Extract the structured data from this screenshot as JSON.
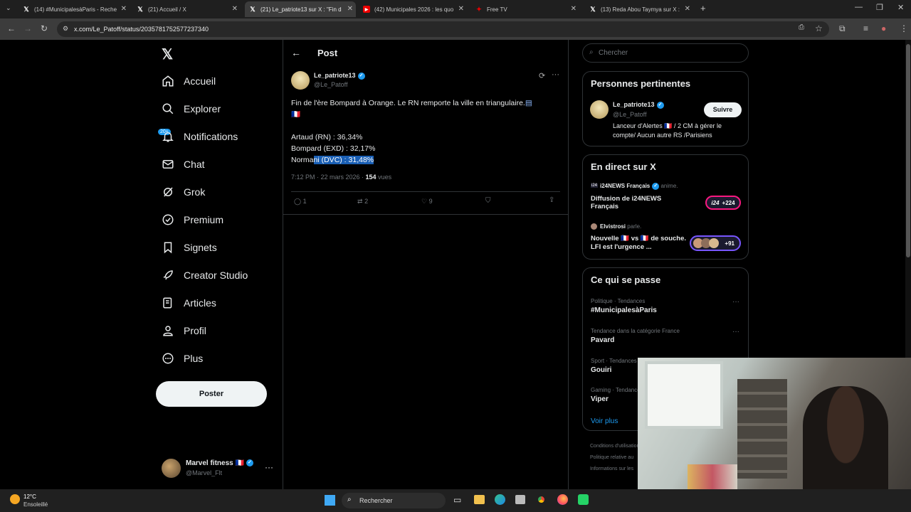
{
  "browser": {
    "tabs": [
      {
        "title": "(14) #MunicipalesàParis - Reche",
        "icon": "x-logo"
      },
      {
        "title": "(21) Accueil / X",
        "icon": "x-logo"
      },
      {
        "title": "(21) Le_patriote13 sur X : \"Fin d",
        "icon": "x-logo"
      },
      {
        "title": "(42) Municipales 2026 : les quo",
        "icon": "youtube-logo"
      },
      {
        "title": "Free TV",
        "icon": "freetv-logo"
      },
      {
        "title": "(13) Reda Abou Taymya sur X : ",
        "icon": "x-logo"
      }
    ],
    "url": "x.com/Le_Patoff/status/2035781752577237340"
  },
  "nav": {
    "items": [
      {
        "label": "Accueil",
        "icon": "home-icon"
      },
      {
        "label": "Explorer",
        "icon": "search-icon"
      },
      {
        "label": "Notifications",
        "icon": "bell-icon"
      },
      {
        "label": "Chat",
        "icon": "mail-icon"
      },
      {
        "label": "Grok",
        "icon": "grok-icon"
      },
      {
        "label": "Premium",
        "icon": "premium-icon"
      },
      {
        "label": "Signets",
        "icon": "bookmark-icon"
      },
      {
        "label": "Creator Studio",
        "icon": "rocket-icon"
      },
      {
        "label": "Articles",
        "icon": "article-icon"
      },
      {
        "label": "Profil",
        "icon": "person-icon"
      },
      {
        "label": "Plus",
        "icon": "more-circle-icon"
      }
    ],
    "notif_badge": "20+",
    "post_button": "Poster",
    "account": {
      "name": "Marvel fitness",
      "flag": "🇫🇷",
      "handle": "@Marvel_Flt"
    }
  },
  "post": {
    "header": "Post",
    "author_name": "Le_patriote13",
    "author_handle": "@Le_Patoff",
    "text_line1": "Fin de l'ère Bompard à Orange. Le RN remporte la ville en triangulaire.",
    "text_flag": "🇫🇷",
    "result1": "Artaud (RN) : 36,34%",
    "result2": "Bompard (EXD) : 32,17%",
    "result3_plain": "Norma",
    "result3_highlight": "ni (DVC) : 31,48%",
    "time": "7:12 PM · 22 mars 2026 · ",
    "views_count": "154",
    "views_label": " vues",
    "replies": "1",
    "reposts": "2",
    "likes": "9"
  },
  "search": {
    "placeholder": "Chercher"
  },
  "relevant": {
    "title": "Personnes pertinentes",
    "name": "Le_patriote13",
    "handle": "@Le_Patoff",
    "follow": "Suivre",
    "bio": "Lanceur d'Alertes 🇫🇷 / 2 CM à gérer le compte/ Aucun autre RS /Parisiens"
  },
  "live": {
    "title": "En direct sur X",
    "items": [
      {
        "host": "i24NEWS Français",
        "action": "anime.",
        "title": "Diffusion de i24NEWS Français",
        "count": "+224",
        "pill_label": "i24"
      },
      {
        "host": "Elvistrosi",
        "action": "parle.",
        "title": "Nouvelle 🇫🇷 vs 🇫🇷 de souche. LFI est l'urgence ...",
        "count": "+91"
      }
    ]
  },
  "trends": {
    "title": "Ce qui se passe",
    "items": [
      {
        "meta": "Politique · Tendances",
        "name": "#MunicipalesàParis"
      },
      {
        "meta": "Tendance dans la catégorie France",
        "name": "Pavard"
      },
      {
        "meta": "Sport · Tendances",
        "name": "Gouiri"
      },
      {
        "meta": "Gaming · Tendances",
        "name": "Viper"
      }
    ],
    "more": "Voir plus"
  },
  "footer_links": [
    "Conditions d'utilisation",
    "Politique relative au",
    "Informations sur les"
  ],
  "taskbar": {
    "temp": "12°C",
    "weather": "Ensoleillé",
    "search": "Rechercher"
  },
  "colors": {
    "accent": "#1d9bf0",
    "background": "#000000",
    "border": "#2f3336",
    "muted": "#71767b",
    "highlight": "#1a5fb4"
  }
}
